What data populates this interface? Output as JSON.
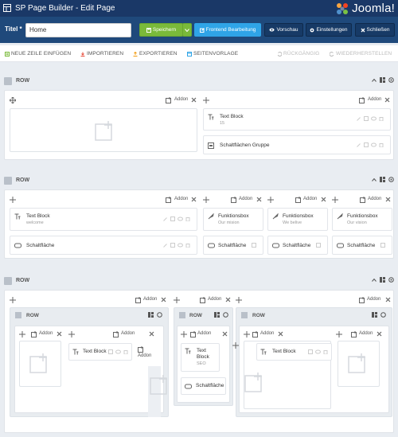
{
  "app": {
    "title": "SP Page Builder - Edit Page",
    "brand": "Joomla!"
  },
  "titlebar": {
    "label": "Titel *",
    "title_value": "Home",
    "buttons": {
      "save": "Speichern",
      "frontend": "Frontend Bearbeitung",
      "preview": "Vorschau",
      "settings": "Einstellungen",
      "close": "Schließen"
    }
  },
  "toolbar": {
    "new_row": "NEUE ZEILE EINFÜGEN",
    "import": "IMPORTIEREN",
    "export": "EXPORTIEREN",
    "template": "SEITENVORLAGE",
    "undo": "RÜCKGÄNGIG",
    "redo": "WIEDERHERSTELLEN"
  },
  "common": {
    "row": "ROW",
    "addon": "Addon"
  },
  "section1": {
    "col2": {
      "addon1": {
        "name": "Text Block",
        "sub": "15"
      },
      "addon2": {
        "name": "Schaltflächen Gruppe"
      }
    }
  },
  "section2": {
    "col1": {
      "addon1": {
        "name": "Text Block",
        "sub": "welcome"
      },
      "addon2": {
        "name": "Schaltfläche"
      }
    },
    "col2": {
      "addon1": {
        "name": "Funktionsbox",
        "sub": "Our mision"
      },
      "addon2": {
        "name": "Schaltfläche"
      }
    },
    "col3": {
      "addon1": {
        "name": "Funktionsbox",
        "sub": "We belive"
      },
      "addon2": {
        "name": "Schaltfläche"
      }
    },
    "col4": {
      "addon1": {
        "name": "Funktionsbox",
        "sub": "Our vision"
      },
      "addon2": {
        "name": "Schaltfläche"
      }
    }
  },
  "section3": {
    "left": {
      "addon1": {
        "name": "Text Block"
      }
    },
    "mid": {
      "addon1": {
        "name": "Text Block",
        "sub": "SEO"
      },
      "addon2": {
        "name": "Schaltfläche"
      }
    },
    "right": {
      "addon1": {
        "name": "Text Block"
      }
    }
  },
  "colors": {
    "topbar": "#1a3867",
    "titlebar": "#1f497b",
    "save_green": "#7aba3a",
    "frontend_blue": "#2fa4e7",
    "dark_button": "#173a66",
    "joomla_orange": "#f39c12"
  }
}
